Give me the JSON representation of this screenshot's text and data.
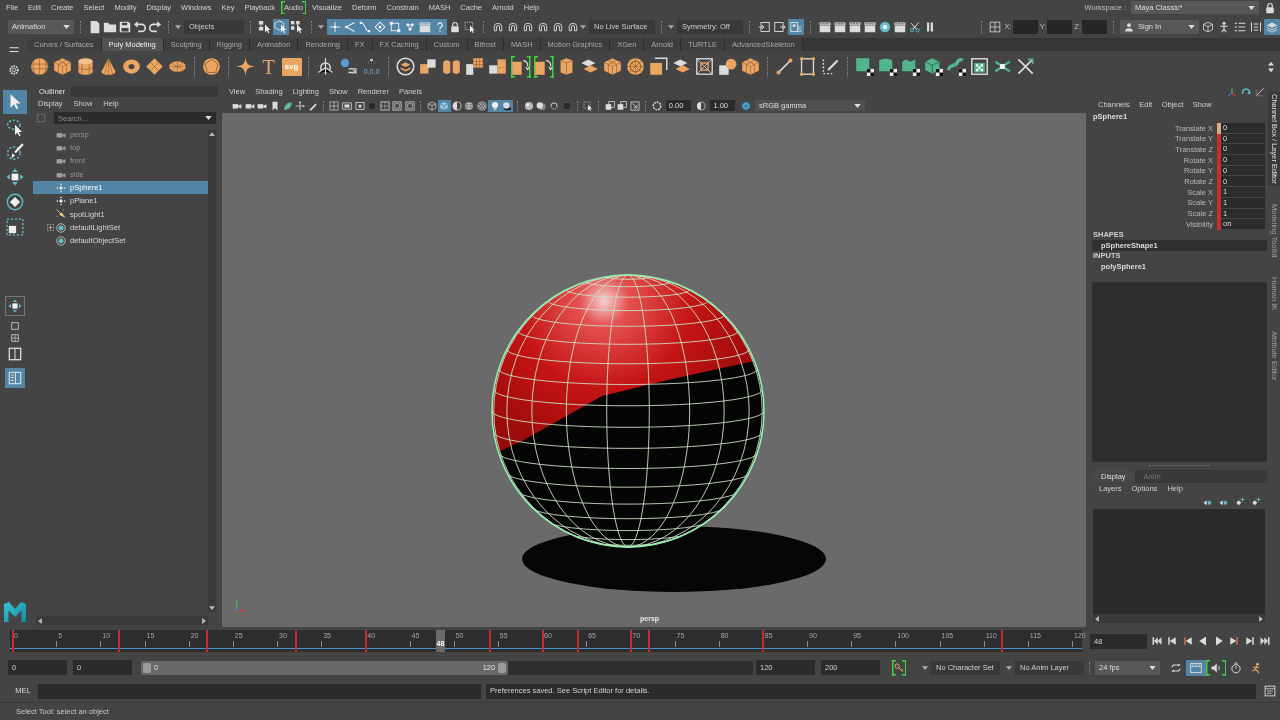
{
  "menu_bar": {
    "items": [
      {
        "label": "File",
        "highlighted": false
      },
      {
        "label": "Edit",
        "highlighted": false
      },
      {
        "label": "Create",
        "highlighted": false
      },
      {
        "label": "Select",
        "highlighted": false
      },
      {
        "label": "Modify",
        "highlighted": false
      },
      {
        "label": "Display",
        "highlighted": false
      },
      {
        "label": "Windows",
        "highlighted": false
      },
      {
        "label": "Key",
        "highlighted": false
      },
      {
        "label": "Playback",
        "highlighted": false
      },
      {
        "label": "Audio",
        "highlighted": true
      },
      {
        "label": "Visualize",
        "highlighted": false
      },
      {
        "label": "Deform",
        "highlighted": false
      },
      {
        "label": "Constrain",
        "highlighted": false
      },
      {
        "label": "MASH",
        "highlighted": false
      },
      {
        "label": "Cache",
        "highlighted": false
      },
      {
        "label": "Arnold",
        "highlighted": false
      },
      {
        "label": "Help",
        "highlighted": false
      }
    ],
    "workspace_label": "Workspace :",
    "workspace": "Maya Classic*"
  },
  "status_line": {
    "menu_set": "Animation",
    "selection_mask": "Objects",
    "select_modes": [
      {
        "selected": false
      },
      {
        "selected": true
      },
      {
        "selected": false
      }
    ],
    "mask_filters": [
      {
        "selected": true
      },
      {
        "selected": true
      },
      {
        "selected": true
      },
      {
        "selected": true
      },
      {
        "selected": true
      },
      {
        "selected": true
      },
      {
        "selected": true
      },
      {
        "selected": true
      }
    ],
    "live_surface": "No Live Surface",
    "symmetry": "Symmetry: Off",
    "render_toggles": [
      {
        "selected": false
      },
      {
        "selected": false
      },
      {
        "selected": true
      }
    ],
    "coordinates": [
      {
        "label": "X:"
      },
      {
        "label": "Y:"
      },
      {
        "label": "Z:"
      }
    ],
    "sign_in": "Sign In",
    "panel_toggles": [
      {
        "selected": false
      },
      {
        "selected": false
      },
      {
        "selected": false
      },
      {
        "selected": false
      },
      {
        "selected": true
      }
    ]
  },
  "shelf": {
    "tabs": [
      {
        "label": "Curves / Surfaces",
        "selected": false
      },
      {
        "label": "Poly Modeling",
        "selected": true
      },
      {
        "label": "Sculpting",
        "selected": false
      },
      {
        "label": "Rigging",
        "selected": false
      },
      {
        "label": "Animation",
        "selected": false
      },
      {
        "label": "Rendering",
        "selected": false
      },
      {
        "label": "FX",
        "selected": false
      },
      {
        "label": "FX Caching",
        "selected": false
      },
      {
        "label": "Custom",
        "selected": false
      },
      {
        "label": "Bifrost",
        "selected": false
      },
      {
        "label": "MASH",
        "selected": false
      },
      {
        "label": "Motion Graphics",
        "selected": false
      },
      {
        "label": "XGen",
        "selected": false
      },
      {
        "label": "Arnold",
        "selected": false
      },
      {
        "label": "TURTLE",
        "selected": false
      },
      {
        "label": "AdvancedSkeleton",
        "selected": false
      }
    ],
    "buttons": [
      {
        "highlighted": false
      },
      {
        "highlighted": false
      },
      {
        "highlighted": false
      },
      {
        "highlighted": false
      },
      {
        "highlighted": false
      },
      {
        "highlighted": false
      },
      {
        "highlighted": false
      },
      {
        "highlighted": false
      },
      {
        "highlighted": false
      },
      {
        "label": "T",
        "highlighted": false
      },
      {
        "label": "svg",
        "highlighted": false
      },
      {
        "highlighted": false
      },
      {
        "highlighted": false
      },
      {
        "label": "0,0,0",
        "highlighted": false
      },
      {
        "highlighted": false
      },
      {
        "highlighted": false
      },
      {
        "highlighted": false
      },
      {
        "highlighted": false
      },
      {
        "highlighted": false
      },
      {
        "highlighted": true
      },
      {
        "highlighted": true
      },
      {
        "highlighted": false
      },
      {
        "highlighted": false
      },
      {
        "highlighted": false
      },
      {
        "highlighted": false
      },
      {
        "highlighted": false
      },
      {
        "highlighted": false
      },
      {
        "highlighted": false
      },
      {
        "highlighted": false
      },
      {
        "highlighted": false
      },
      {
        "highlighted": false
      },
      {
        "highlighted": false
      },
      {
        "highlighted": false
      },
      {
        "highlighted": false
      },
      {
        "highlighted": false
      },
      {
        "highlighted": false
      },
      {
        "highlighted": false
      },
      {
        "highlighted": false
      },
      {
        "highlighted": false
      },
      {
        "highlighted": false
      },
      {
        "highlighted": false
      }
    ]
  },
  "toolbox": {
    "tools": [
      {
        "selected": true
      },
      {
        "selected": false
      },
      {
        "selected": false
      },
      {
        "selected": false
      },
      {
        "selected": false
      },
      {
        "selected": false
      }
    ],
    "layouts": [
      {
        "selected": false
      },
      {
        "selected": false
      },
      {
        "selected": false
      },
      {
        "selected": true
      }
    ]
  },
  "outliner": {
    "tab": "Outliner",
    "menu": [
      "Display",
      "Show",
      "Help"
    ],
    "search": {
      "placeholder": "Search..."
    },
    "items": [
      {
        "label": "persp",
        "kind": "camera",
        "hidden": true,
        "selected": false
      },
      {
        "label": "top",
        "kind": "camera",
        "hidden": true,
        "selected": false
      },
      {
        "label": "front",
        "kind": "camera",
        "hidden": true,
        "selected": false
      },
      {
        "label": "side",
        "kind": "camera",
        "hidden": true,
        "selected": false
      },
      {
        "label": "pSphere1",
        "kind": "transform",
        "hidden": false,
        "selected": true
      },
      {
        "label": "pPlane1",
        "kind": "transform",
        "hidden": false,
        "selected": false
      },
      {
        "label": "spotLight1",
        "kind": "light",
        "hidden": false,
        "selected": false
      },
      {
        "label": "defaultLightSet",
        "kind": "set",
        "hidden": false,
        "selected": false,
        "expanded": false
      },
      {
        "label": "defaultObjectSet",
        "kind": "set",
        "hidden": false,
        "selected": false
      }
    ]
  },
  "viewport": {
    "menu": [
      "View",
      "Shading",
      "Lighting",
      "Show",
      "Renderer",
      "Panels"
    ],
    "display_toggles": [
      {
        "selected": false
      },
      {
        "selected": true
      },
      {
        "selected": false
      },
      {
        "selected": false
      },
      {
        "selected": false
      },
      {
        "selected": true
      },
      {
        "selected": true
      }
    ],
    "exposure": "0.00",
    "gamma": "1.00",
    "color_space": "sRGB gamma",
    "camera": "persp"
  },
  "channel_box": {
    "menu": [
      "Channels",
      "Edit",
      "Object",
      "Show"
    ],
    "object": "pSphere1",
    "channels": [
      {
        "name": "Translate X",
        "value": "0",
        "color": "#d9a98a"
      },
      {
        "name": "Translate Y",
        "value": "0",
        "color": "#cc2b2b"
      },
      {
        "name": "Translate Z",
        "value": "0",
        "color": "#cc2b2b"
      },
      {
        "name": "Rotate X",
        "value": "0",
        "color": "#cc2b2b"
      },
      {
        "name": "Rotate Y",
        "value": "0",
        "color": "#cc2b2b"
      },
      {
        "name": "Rotate Z",
        "value": "0",
        "color": "#cc2b2b"
      },
      {
        "name": "Scale X",
        "value": "1",
        "color": "#cc2b2b"
      },
      {
        "name": "Scale Y",
        "value": "1",
        "color": "#cc2b2b"
      },
      {
        "name": "Scale Z",
        "value": "1",
        "color": "#cc2b2b"
      },
      {
        "name": "Visibility",
        "value": "on",
        "color": "#cc2b2b"
      }
    ],
    "shapes_heading": "SHAPES",
    "shapes": [
      {
        "label": "pSphereShape1",
        "selected": true
      }
    ],
    "inputs_heading": "INPUTS",
    "inputs": [
      {
        "label": "polySphere1",
        "selected": false
      }
    ]
  },
  "layer_editor": {
    "tabs": [
      {
        "label": "Display",
        "selected": true
      },
      {
        "label": "Anim",
        "selected": false
      }
    ],
    "menu": [
      "Layers",
      "Options",
      "Help"
    ]
  },
  "side_tabs": [
    {
      "label": "Channel Box / Layer Editor",
      "selected": true
    },
    {
      "label": "Modeling Toolkit",
      "selected": false
    },
    {
      "label": "Human IK",
      "selected": false
    },
    {
      "label": "Attribute Editor",
      "selected": false
    }
  ],
  "time_slider": {
    "ticks": [
      "0",
      "5",
      "10",
      "15",
      "20",
      "25",
      "30",
      "35",
      "40",
      "45",
      "50",
      "55",
      "60",
      "65",
      "70",
      "75",
      "80",
      "85",
      "90",
      "95",
      "100",
      "105",
      "110",
      "115",
      "120"
    ],
    "playhead": {
      "label": "48",
      "level": 0.4
    },
    "keys": [
      {
        "level": 0
      },
      {
        "level": 0.1
      },
      {
        "level": 0.183
      },
      {
        "level": 0.267
      },
      {
        "level": 0.333
      },
      {
        "level": 0.45
      },
      {
        "level": 0.5
      },
      {
        "level": 0.533
      },
      {
        "level": 0.583
      },
      {
        "level": 0.6
      },
      {
        "level": 0.708
      },
      {
        "level": 0.933
      }
    ],
    "current_frame": "48"
  },
  "range_slider": {
    "start": "0",
    "playback_start": "0",
    "level": 0.6,
    "range_start": "0",
    "range_end": "120",
    "playback_end": "120",
    "end": "200",
    "key_button": {
      "highlighted": true
    },
    "character_set": "No Character Set",
    "anim_layer": "No Anim Layer",
    "fps": "24 fps",
    "toggles": [
      {
        "selected": false,
        "highlighted": false
      },
      {
        "selected": true,
        "highlighted": false
      },
      {
        "selected": false,
        "highlighted": true
      },
      {
        "selected": false,
        "highlighted": false
      },
      {
        "selected": false,
        "highlighted": false
      }
    ]
  },
  "command_line": {
    "language": "MEL",
    "result": "Preferences saved. See Script Editor for details."
  },
  "help_line": "Select Tool: select an object"
}
